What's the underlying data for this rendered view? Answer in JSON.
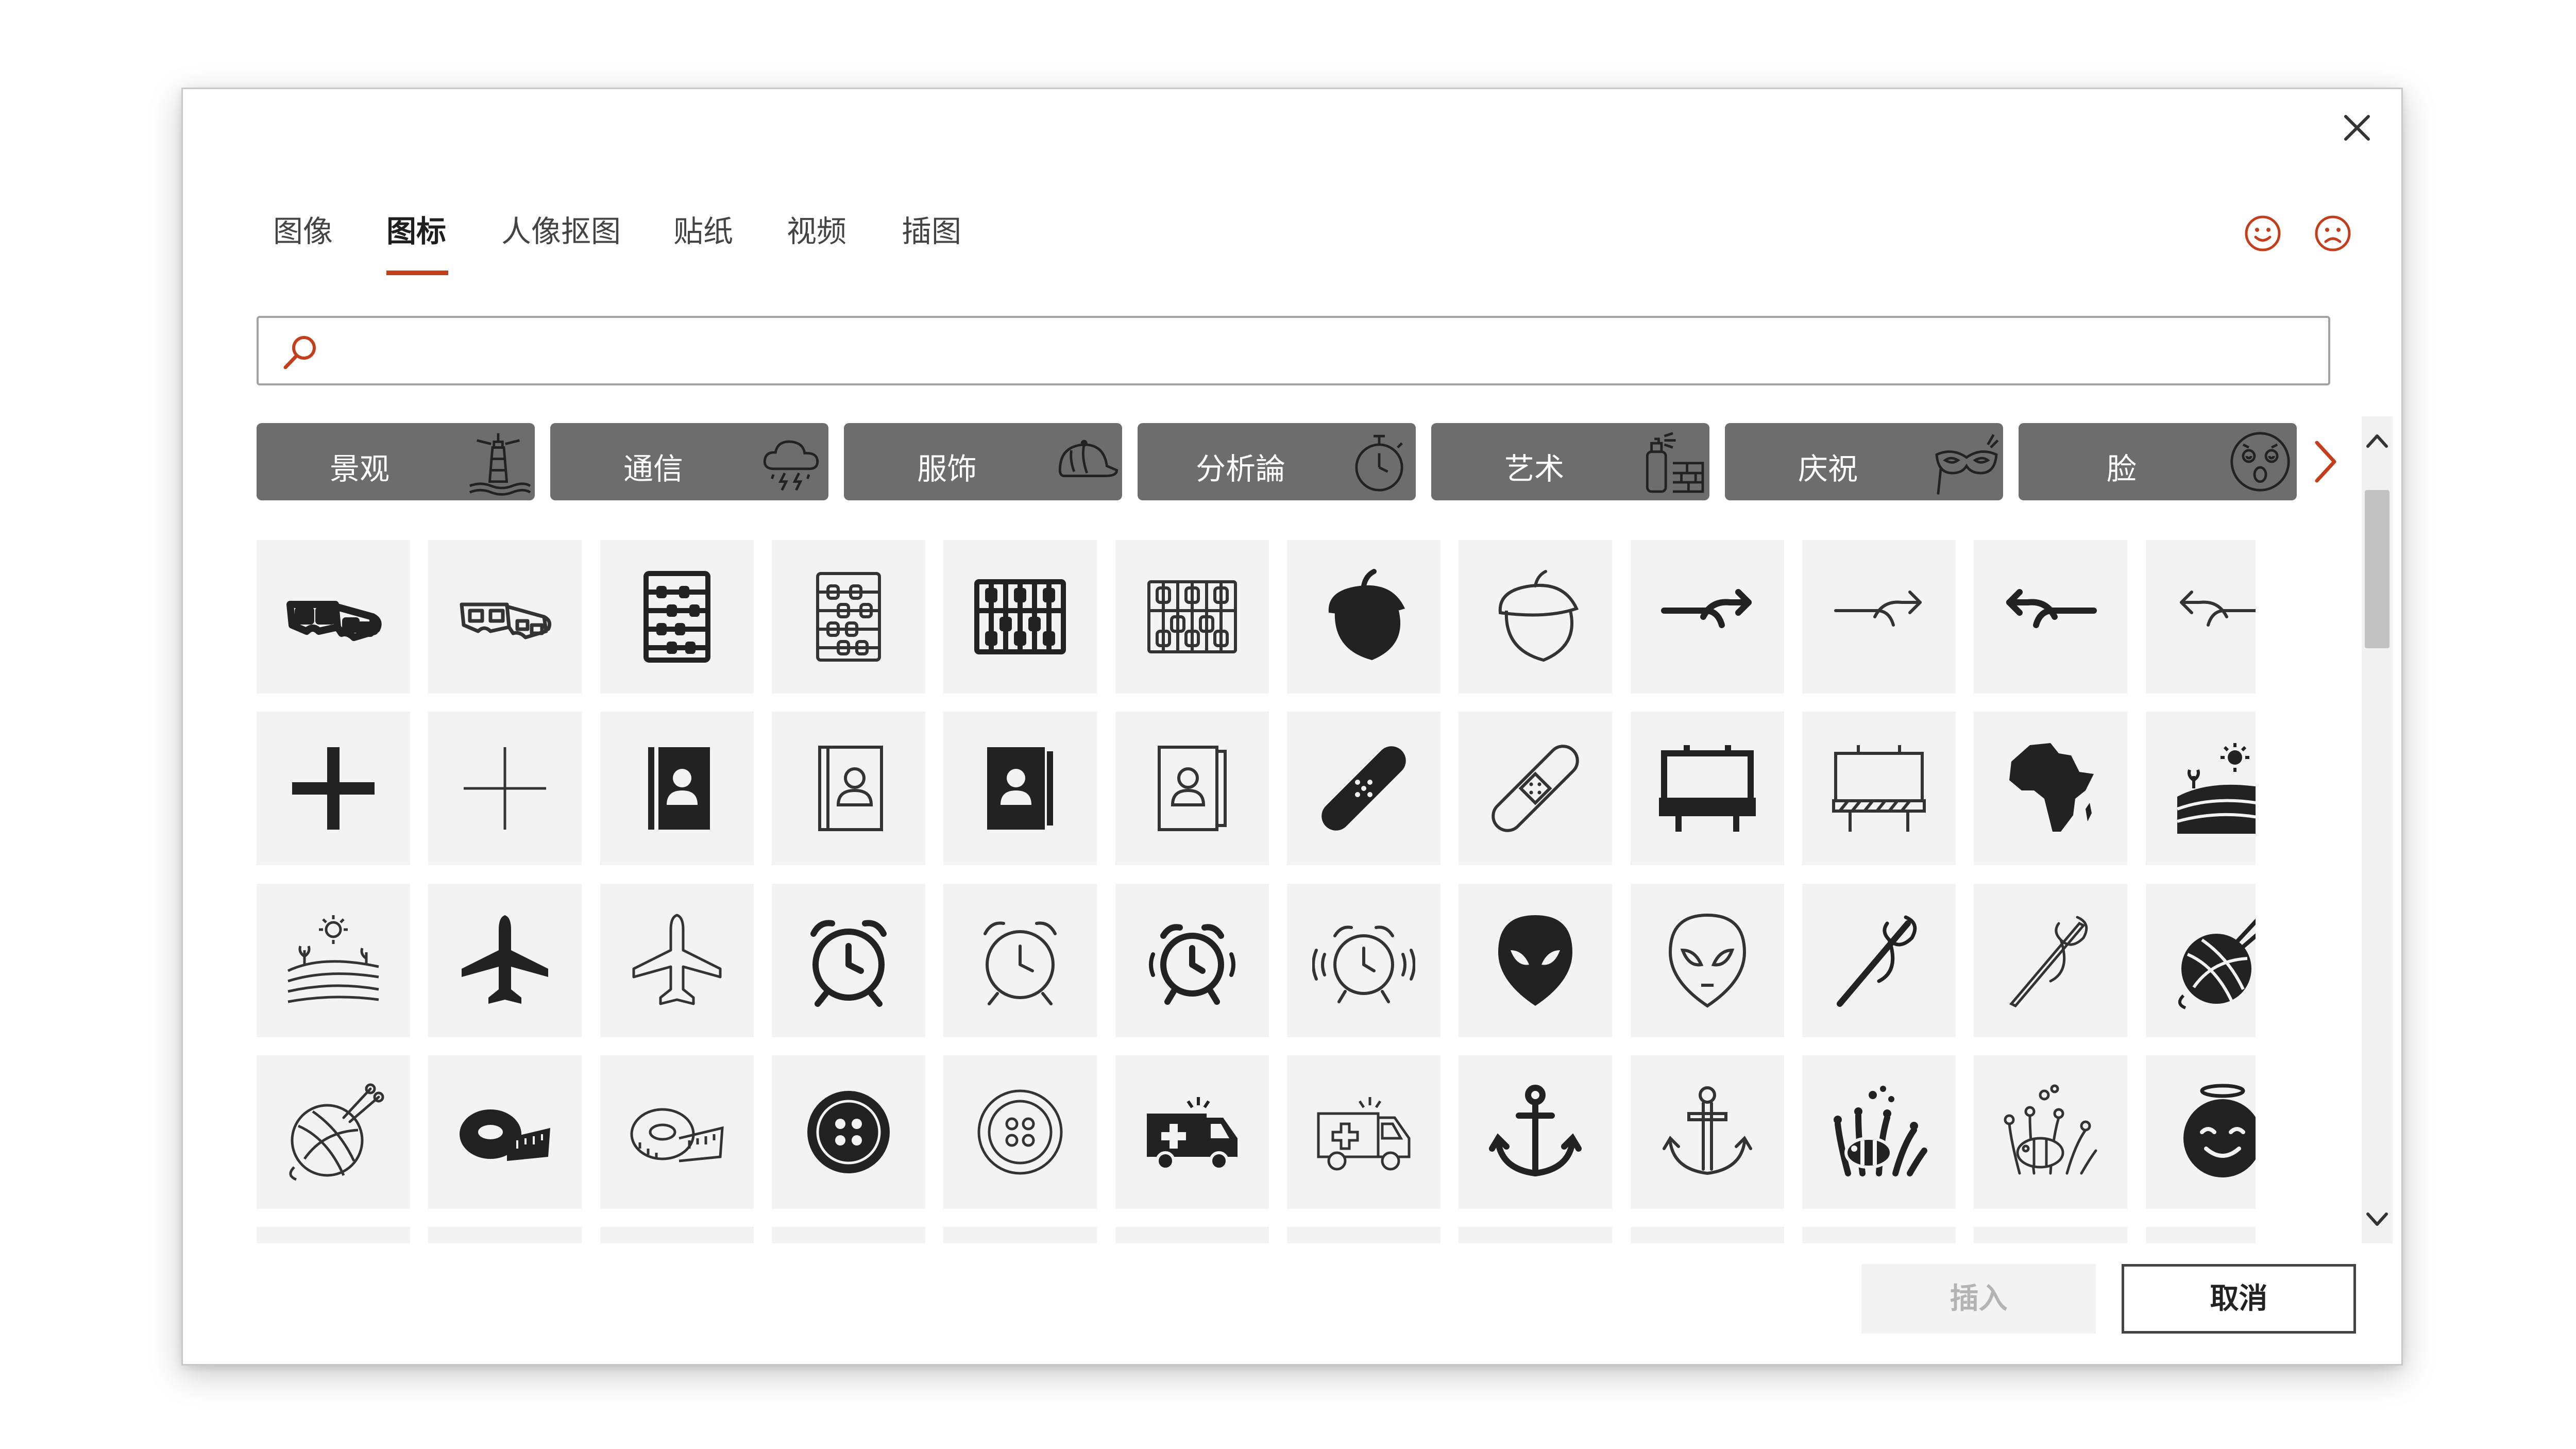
{
  "tabs": [
    {
      "label": "图像"
    },
    {
      "label": "图标"
    },
    {
      "label": "人像抠图"
    },
    {
      "label": "贴纸"
    },
    {
      "label": "视频"
    },
    {
      "label": "插图"
    }
  ],
  "active_tab": "图标",
  "search": {
    "value": "",
    "placeholder": ""
  },
  "categories": [
    {
      "label": "景观",
      "icon": "lighthouse-icon"
    },
    {
      "label": "通信",
      "icon": "storm-cloud-icon"
    },
    {
      "label": "服饰",
      "icon": "cap-icon"
    },
    {
      "label": "分析論",
      "icon": "stopwatch-icon"
    },
    {
      "label": "艺术",
      "icon": "spray-paint-icon"
    },
    {
      "label": "庆祝",
      "icon": "party-mask-icon"
    },
    {
      "label": "脸",
      "icon": "dizzy-face-icon"
    }
  ],
  "icons": [
    "3d-glasses-filled",
    "3d-glasses-outline",
    "abacus-filled",
    "abacus-outline",
    "abacus-wide-filled",
    "abacus-wide-outline",
    "acorn-filled",
    "acorn-outline",
    "curve-arrow-right-filled",
    "curve-arrow-right-outline",
    "curve-arrow-left-filled",
    "curve-arrow-left-outline",
    "plus-filled",
    "plus-outline",
    "address-book-filled",
    "address-book-outline",
    "address-book-2-filled",
    "address-book-2-outline",
    "bandage-filled",
    "bandage-outline",
    "billboard-filled",
    "billboard-outline",
    "africa-filled",
    "field-sun-filled",
    "field-sun-outline",
    "airplane-filled",
    "airplane-outline",
    "alarm-clock-filled",
    "alarm-clock-outline",
    "alarm-ringing-filled",
    "alarm-ringing-outline",
    "alien-filled",
    "alien-outline",
    "needle-thread-filled",
    "needle-thread-outline",
    "yarn-ball-filled",
    "yarn-ball-outline",
    "tape-measure-filled",
    "tape-measure-outline",
    "button-filled",
    "button-outline",
    "ambulance-filled",
    "ambulance-outline",
    "anchor-filled",
    "anchor-outline",
    "anemone-fish-filled",
    "anemone-fish-outline",
    "angel-face-filled"
  ],
  "buttons": {
    "insert": "插入",
    "cancel": "取消"
  },
  "colors": {
    "accent": "#c43e1c",
    "category_bg": "#6d6d6d",
    "tile_bg": "#f3f3f3",
    "icon": "#222222"
  }
}
